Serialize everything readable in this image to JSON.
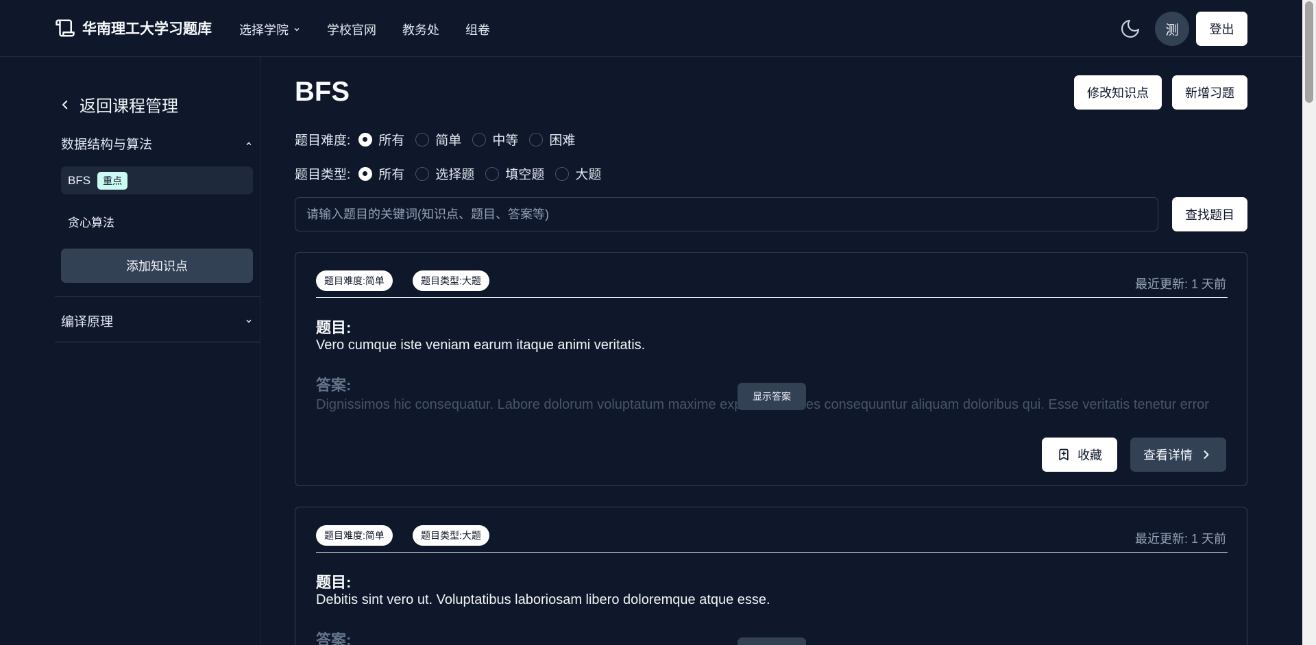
{
  "header": {
    "brand": "华南理工大学习题库",
    "nav": [
      {
        "label": "选择学院",
        "has_dropdown": true
      },
      {
        "label": "学校官网"
      },
      {
        "label": "教务处"
      },
      {
        "label": "组卷"
      }
    ],
    "avatar_text": "测",
    "login_label": "登出"
  },
  "sidebar": {
    "back_label": "返回课程管理",
    "groups": [
      {
        "title": "数据结构与算法",
        "expanded": true,
        "items": [
          {
            "label": "BFS",
            "badge": "重点",
            "active": true
          },
          {
            "label": "贪心算法"
          }
        ],
        "add_label": "添加知识点"
      },
      {
        "title": "编译原理",
        "expanded": false
      }
    ]
  },
  "main": {
    "title": "BFS",
    "edit_kp_label": "修改知识点",
    "new_question_label": "新增习题",
    "filters": {
      "difficulty": {
        "label": "题目难度:",
        "options": [
          "所有",
          "简单",
          "中等",
          "困难"
        ],
        "selected": "所有"
      },
      "type": {
        "label": "题目类型:",
        "options": [
          "所有",
          "选择题",
          "填空题",
          "大题"
        ],
        "selected": "所有"
      }
    },
    "search": {
      "placeholder": "请输入题目的关键词(知识点、题目、答案等)",
      "button_label": "查找题目"
    },
    "questions": [
      {
        "difficulty_tag": "题目难度:简单",
        "type_tag": "题目类型:大题",
        "updated": "最近更新: 1 天前",
        "question_label": "题目:",
        "question_text": "Vero cumque iste veniam earum itaque animi veritatis.",
        "answer_label": "答案:",
        "answer_text": "Dignissimos hic consequatur. Labore dolorum voluptatum maxime expedita dolores consequuntur aliquam doloribus qui. Esse veritatis tenetur error laborum.",
        "show_answer_label": "显示答案",
        "favorite_label": "收藏",
        "detail_label": "查看详情"
      },
      {
        "difficulty_tag": "题目难度:简单",
        "type_tag": "题目类型:大题",
        "updated": "最近更新: 1 天前",
        "question_label": "题目:",
        "question_text": "Debitis sint vero ut. Voluptatibus laboriosam libero doloremque atque esse.",
        "answer_label": "答案:"
      }
    ]
  },
  "colors": {
    "background": "#0f172a",
    "surface": "#1e293b",
    "muted_button": "#334155",
    "badge_bg": "#ccfbf1",
    "white": "#ffffff"
  },
  "icons": [
    "book-scroll-icon",
    "chevron-down-icon",
    "moon-icon",
    "chevron-left-icon",
    "chevron-up-icon",
    "bookmark-plus-icon",
    "chevron-right-icon"
  ]
}
